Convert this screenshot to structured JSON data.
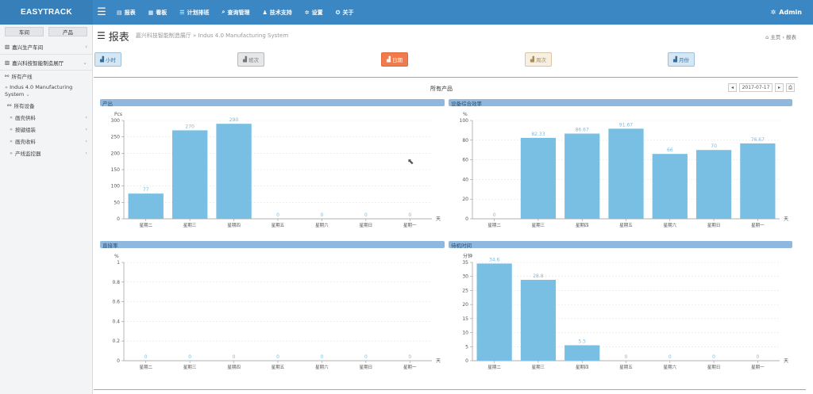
{
  "app": {
    "brand": "EASYTRACK",
    "admin": "Admin"
  },
  "nav": [
    {
      "icon": "chart-icon",
      "label": "报表"
    },
    {
      "icon": "board-icon",
      "label": "看板"
    },
    {
      "icon": "list-icon",
      "label": "计划排班"
    },
    {
      "icon": "search-icon",
      "label": "查询管理"
    },
    {
      "icon": "users-icon",
      "label": "技术支持"
    },
    {
      "icon": "settings-icon",
      "label": "设置"
    },
    {
      "icon": "info-icon",
      "label": "关于"
    }
  ],
  "sidebar": {
    "tabs": [
      "车间",
      "产品"
    ],
    "rows": [
      {
        "label": "嘉兴生产车间"
      },
      {
        "label": "嘉兴科技智能制造展厅"
      }
    ],
    "all_lines": "所有产线",
    "line_name": "Indus 4.0 Manufacturing System",
    "all_devices": "所有设备",
    "devices": [
      "画壳供料",
      "按键组装",
      "画壳收料",
      "产线监控器"
    ]
  },
  "page": {
    "title": "报表",
    "subtitle": "嘉兴科技智能制造展厅 » Indus 4.0 Manufacturing System",
    "breadcrumb": "主页 › 报表"
  },
  "period_buttons": [
    "小时",
    "班次",
    "日期",
    "周次",
    "月份"
  ],
  "panel": {
    "title": "所有产品",
    "date": "2017-07-17"
  },
  "charts": [
    {
      "title": "产出",
      "unit": "Pcs",
      "xunit": "天",
      "categories": [
        "星期二",
        "星期三",
        "星期四",
        "星期五",
        "星期六",
        "星期日",
        "星期一"
      ],
      "values": [
        77,
        270,
        290,
        0,
        0,
        0,
        0
      ],
      "labels": [
        "77",
        "270",
        "290",
        "0",
        "0",
        "0",
        "0"
      ],
      "ylim": [
        0,
        300
      ],
      "ticks": [
        0,
        50,
        100,
        150,
        200,
        250,
        300
      ]
    },
    {
      "title": "设备综合效率",
      "unit": "%",
      "xunit": "天",
      "categories": [
        "星期二",
        "星期三",
        "星期四",
        "星期五",
        "星期六",
        "星期日",
        "星期一"
      ],
      "values": [
        0,
        82.33,
        86.67,
        91.67,
        66,
        70,
        76.67
      ],
      "labels": [
        "0",
        "82.33",
        "86.67",
        "91.67",
        "66",
        "70",
        "76.67"
      ],
      "ylim": [
        0,
        100
      ],
      "ticks": [
        0,
        20,
        40,
        60,
        80,
        100
      ]
    },
    {
      "title": "直接率",
      "unit": "%",
      "xunit": "天",
      "categories": [
        "星期二",
        "星期三",
        "星期四",
        "星期五",
        "星期六",
        "星期日",
        "星期一"
      ],
      "values": [
        0,
        0,
        0,
        0,
        0,
        0,
        0
      ],
      "labels": [
        "0",
        "0",
        "0",
        "0",
        "0",
        "0",
        "0"
      ],
      "ylim": [
        0,
        1
      ],
      "ticks": [
        0,
        0.2,
        0.4,
        0.6,
        0.8,
        1
      ]
    },
    {
      "title": "待机时间",
      "unit": "分钟",
      "xunit": "天",
      "categories": [
        "星期二",
        "星期三",
        "星期四",
        "星期五",
        "星期六",
        "星期日",
        "星期一"
      ],
      "values": [
        34.6,
        28.8,
        5.5,
        0,
        0,
        0,
        0
      ],
      "labels": [
        "34.6",
        "28.8",
        "5.5",
        "0",
        "0",
        "0",
        "0"
      ],
      "ylim": [
        0,
        35
      ],
      "ticks": [
        0,
        5,
        10,
        15,
        20,
        25,
        30,
        35
      ]
    }
  ],
  "chart_data": [
    {
      "type": "bar",
      "title": "产出",
      "ylabel": "Pcs",
      "xlabel": "天",
      "categories": [
        "星期二",
        "星期三",
        "星期四",
        "星期五",
        "星期六",
        "星期日",
        "星期一"
      ],
      "values": [
        77,
        270,
        290,
        0,
        0,
        0,
        0
      ],
      "ylim": [
        0,
        300
      ]
    },
    {
      "type": "bar",
      "title": "设备综合效率",
      "ylabel": "%",
      "xlabel": "天",
      "categories": [
        "星期二",
        "星期三",
        "星期四",
        "星期五",
        "星期六",
        "星期日",
        "星期一"
      ],
      "values": [
        0,
        82.33,
        86.67,
        91.67,
        66,
        70,
        76.67
      ],
      "ylim": [
        0,
        100
      ]
    },
    {
      "type": "bar",
      "title": "直接率",
      "ylabel": "%",
      "xlabel": "天",
      "categories": [
        "星期二",
        "星期三",
        "星期四",
        "星期五",
        "星期六",
        "星期日",
        "星期一"
      ],
      "values": [
        0,
        0,
        0,
        0,
        0,
        0,
        0
      ],
      "ylim": [
        0,
        1
      ]
    },
    {
      "type": "bar",
      "title": "待机时间",
      "ylabel": "分钟",
      "xlabel": "天",
      "categories": [
        "星期二",
        "星期三",
        "星期四",
        "星期五",
        "星期六",
        "星期日",
        "星期一"
      ],
      "values": [
        34.6,
        28.8,
        5.5,
        0,
        0,
        0,
        0
      ],
      "ylim": [
        0,
        35
      ]
    }
  ],
  "colors": {
    "bar": "#78bfe3",
    "label": "#7db9dc",
    "top": "#3a87c4",
    "accent": "#ef7b4e"
  }
}
